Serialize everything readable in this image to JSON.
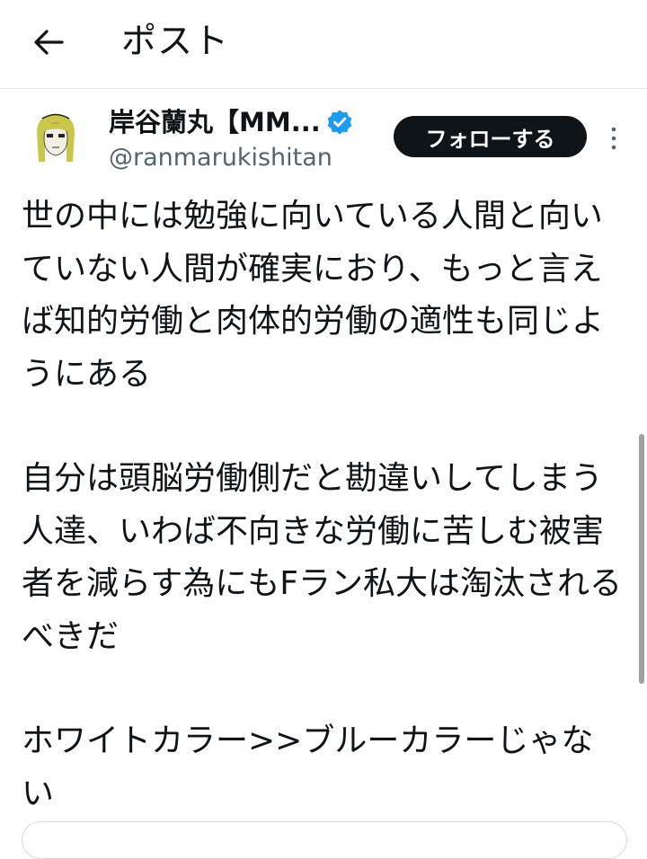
{
  "header": {
    "back_icon": "arrow-left-icon",
    "title": "ポスト"
  },
  "author": {
    "display_name": "岸谷蘭丸【MM...",
    "handle": "@ranmarukishitan",
    "verified_icon": "verified-badge-icon",
    "verified_color": "#1d9bf0",
    "follow_label": "フォローする",
    "more_icon": "more-vertical-icon"
  },
  "tweet": {
    "paragraphs": [
      "世の中には勉強に向いている人間と向いていない人間が確実におり、もっと言えば知的労働と肉体的労働の適性も同じようにある",
      "自分は頭脳労働側だと勘違いしてしまう人達、いわば不向きな労働に苦しむ被害者を減らす為にもFラン私大は淘汰されるべきだ",
      "ホワイトカラー>>ブルーカラーじゃない"
    ]
  },
  "colors": {
    "text": "#0f1419",
    "secondary": "#536471",
    "follow_bg": "#0f1419",
    "follow_text": "#ffffff",
    "divider": "#e6e6e6"
  }
}
